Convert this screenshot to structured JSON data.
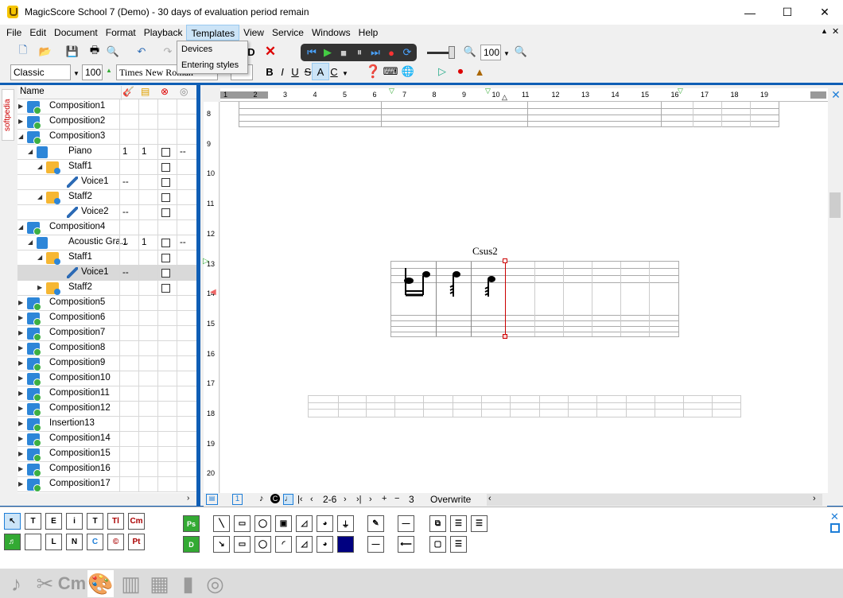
{
  "window": {
    "title": "MagicScore School 7 (Demo) - 30 days of evaluation period remain",
    "minimize": "—",
    "maximize": "☐",
    "close": "✕"
  },
  "menu": [
    "File",
    "Edit",
    "Document",
    "Format",
    "Playback",
    "Templates",
    "View",
    "Service",
    "Windows",
    "Help"
  ],
  "templates_menu": {
    "items": [
      "Devices",
      "Entering styles"
    ]
  },
  "toolbar": {
    "style_value": "Classic",
    "size_value": "100",
    "font_value": "Times New Roman",
    "zoom_value": "100",
    "bold": "B",
    "italic": "I",
    "underline": "U",
    "strike": "S",
    "text_a": "A",
    "text_c": "C"
  },
  "tree": {
    "header": "Name",
    "rows": [
      {
        "label": "Composition1"
      },
      {
        "label": "Composition2"
      },
      {
        "label": "Composition3"
      },
      {
        "label": "Piano",
        "c1": "1",
        "c2": "1",
        "c4": "--"
      },
      {
        "label": "Staff1"
      },
      {
        "label": "Voice1",
        "c1": "--"
      },
      {
        "label": "Staff2"
      },
      {
        "label": "Voice2",
        "c1": "--"
      },
      {
        "label": "Composition4"
      },
      {
        "label": "Acoustic Gra...",
        "c1": "1",
        "c2": "1",
        "c4": "--"
      },
      {
        "label": "Staff1"
      },
      {
        "label": "Voice1",
        "c1": "--"
      },
      {
        "label": "Staff2"
      },
      {
        "label": "Composition5"
      },
      {
        "label": "Composition6"
      },
      {
        "label": "Composition7"
      },
      {
        "label": "Composition8"
      },
      {
        "label": "Composition9"
      },
      {
        "label": "Composition10"
      },
      {
        "label": "Composition11"
      },
      {
        "label": "Composition12"
      },
      {
        "label": "Insertion13"
      },
      {
        "label": "Composition14"
      },
      {
        "label": "Composition15"
      },
      {
        "label": "Composition16"
      },
      {
        "label": "Composition17"
      }
    ]
  },
  "softpedia": "softpedia",
  "ruler": {
    "h": [
      "1",
      "2",
      "3",
      "4",
      "5",
      "6",
      "7",
      "8",
      "9",
      "10",
      "11",
      "12",
      "13",
      "14",
      "15",
      "16",
      "17",
      "18",
      "19"
    ],
    "v": [
      "8",
      "9",
      "10",
      "11",
      "12",
      "13",
      "14",
      "15",
      "16",
      "17",
      "18",
      "19",
      "20"
    ]
  },
  "score": {
    "chord": "Csus2"
  },
  "status": {
    "range": "2-6",
    "count": "3",
    "mode": "Overwrite",
    "page": "1"
  },
  "palette": {
    "row1": [
      "Q",
      "T",
      "E",
      "i",
      "T",
      "Tl",
      "Cm"
    ],
    "row2": [
      "",
      "",
      "L",
      "N",
      "C",
      "©",
      "Pt"
    ],
    "mid1": "Ps",
    "mid2": "D"
  },
  "colors": {
    "accent": "#0f5eb5",
    "selection": "#cce4f7"
  }
}
